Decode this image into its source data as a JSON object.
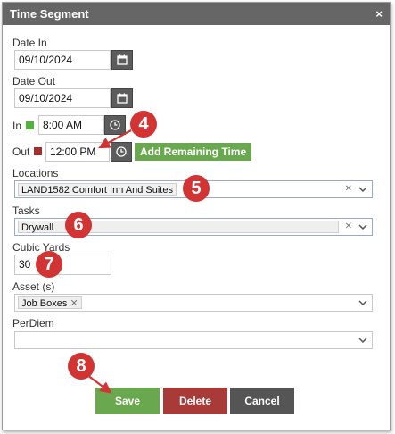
{
  "dialog": {
    "title": "Time Segment",
    "close_label": "×"
  },
  "fields": {
    "date_in": {
      "label": "Date In",
      "value": "09/10/2024"
    },
    "date_out": {
      "label": "Date Out",
      "value": "09/10/2024"
    },
    "time_in": {
      "label": "In",
      "value": "8:00 AM",
      "indicator_color": "#53b23b"
    },
    "time_out": {
      "label": "Out",
      "value": "12:00 PM",
      "indicator_color": "#a32e2e"
    },
    "add_remaining_label": "Add Remaining Time",
    "locations": {
      "label": "Locations",
      "value": "LAND1582 Comfort Inn And Suites"
    },
    "tasks": {
      "label": "Tasks",
      "value": "Drywall"
    },
    "cubic_yards": {
      "label": "Cubic Yards",
      "value": "30"
    },
    "assets": {
      "label": "Asset (s)",
      "tag": "Job Boxes"
    },
    "perdiem": {
      "label": "PerDiem",
      "value": ""
    }
  },
  "buttons": {
    "save": "Save",
    "delete": "Delete",
    "cancel": "Cancel"
  },
  "callouts": [
    "4",
    "5",
    "6",
    "7",
    "8"
  ],
  "colors": {
    "titlebar": "#666666",
    "save": "#6aa84f",
    "delete": "#a83a37",
    "cancel": "#555555",
    "callout": "#d23333"
  }
}
